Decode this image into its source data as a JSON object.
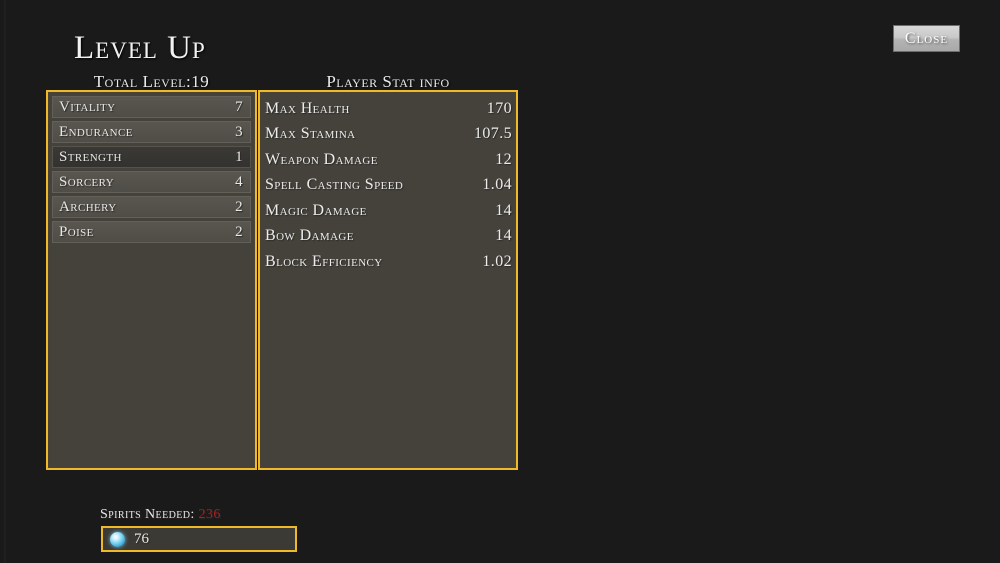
{
  "window": {
    "title": "Level Up"
  },
  "close_button": {
    "label": "Close"
  },
  "left_panel": {
    "header": "Total Level:19",
    "attributes": [
      {
        "name": "Vitality",
        "value": "7"
      },
      {
        "name": "Endurance",
        "value": "3"
      },
      {
        "name": "Strength",
        "value": "1"
      },
      {
        "name": "Sorcery",
        "value": "4"
      },
      {
        "name": "Archery",
        "value": "2"
      },
      {
        "name": "Poise",
        "value": "2"
      }
    ],
    "spirits": {
      "label": "Spirits Needed:",
      "needed": "236",
      "owned": "76",
      "orb_icon": "spirit-orb-icon"
    }
  },
  "right_panel": {
    "header": "Player Stat info",
    "stats": [
      {
        "name": "Max Health",
        "value": "170"
      },
      {
        "name": "Max Stamina",
        "value": "107.5"
      },
      {
        "name": "Weapon Damage",
        "value": "12"
      },
      {
        "name": "Spell Casting Speed",
        "value": "1.04"
      },
      {
        "name": "Magic Damage",
        "value": "14"
      },
      {
        "name": "Bow Damage",
        "value": "14"
      },
      {
        "name": "Block Efficiency",
        "value": "1.02"
      }
    ]
  },
  "colors": {
    "background": "#1a1a1a",
    "panel_fill": "#45423c",
    "gold_border": "#f0b92a",
    "text": "#ececec",
    "warning_red": "#a81f22",
    "orb_blue": "#3ba6d8"
  }
}
